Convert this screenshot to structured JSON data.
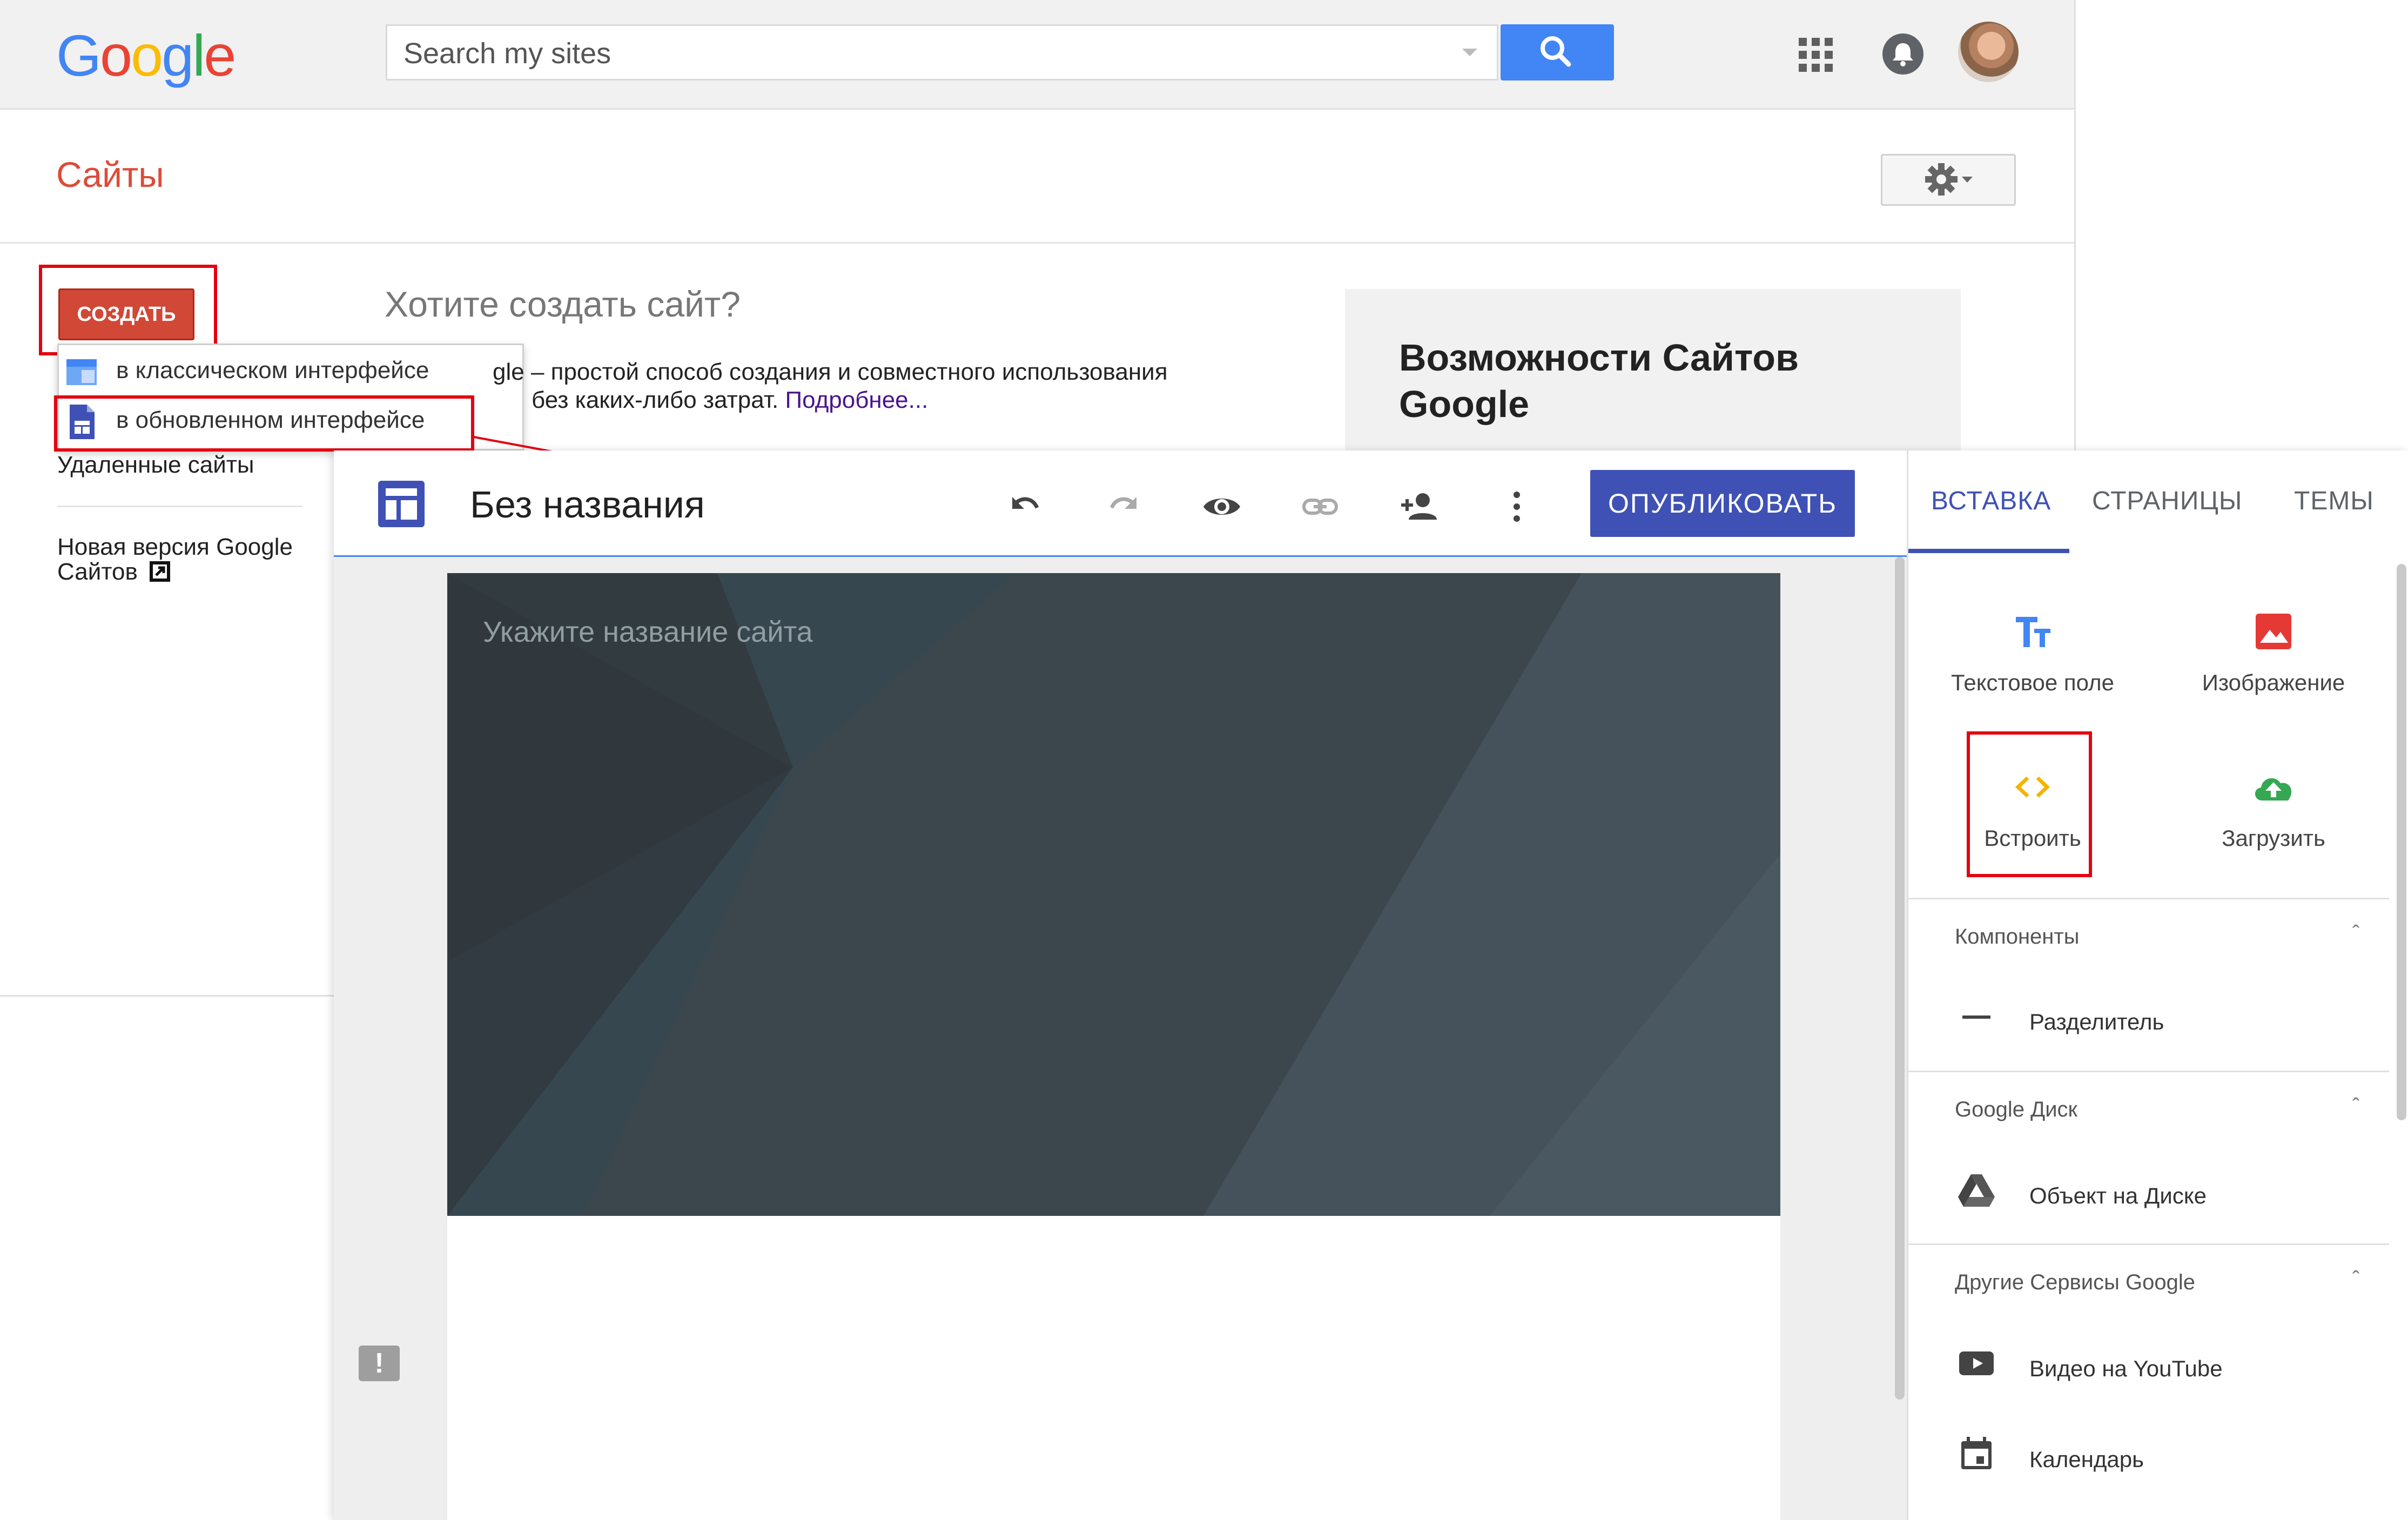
{
  "classic": {
    "search": {
      "placeholder": "Search my sites"
    },
    "sites_title": "Сайты",
    "create_button": "СОЗДАТЬ",
    "create_menu": [
      {
        "label": "в классическом интерфейсе",
        "icon": "classic-sites-icon"
      },
      {
        "label": "в обновленном интерфейсе",
        "icon": "new-sites-icon"
      }
    ],
    "promo": {
      "title": "Хотите создать сайт?",
      "line1": "gle – простой способ создания и совместного использования",
      "line2": "без каких-либо затрат. ",
      "link": "Подробнее..."
    },
    "features_title": "Возможности Сайтов Google",
    "deleted_sites": "Удаленные сайты",
    "new_version": "Новая версия Google Сайтов"
  },
  "editor": {
    "title": "Без названия",
    "publish_button": "ОПУБЛИКОВАТЬ",
    "site_name_placeholder": "Укажите название сайта",
    "tabs": [
      "ВСТАВКА",
      "СТРАНИЦЫ",
      "ТЕМЫ"
    ],
    "insert_tools": [
      "Текстовое поле",
      "Изображение",
      "Встроить",
      "Загрузить"
    ],
    "sections": [
      {
        "title": "Компоненты",
        "item": "Разделитель"
      },
      {
        "title": "Google Диск",
        "item": "Объект на Диске"
      },
      {
        "title": "Другие Сервисы Google",
        "items": [
          "Видео на YouTube",
          "Календарь"
        ]
      }
    ]
  },
  "colors": {
    "google_red": "#dd4b39",
    "create_red": "#d14836",
    "highlight_red": "#e4000f",
    "editor_indigo": "#3f51b5",
    "header_dark": "#37474f",
    "search_blue": "#4285f4"
  }
}
